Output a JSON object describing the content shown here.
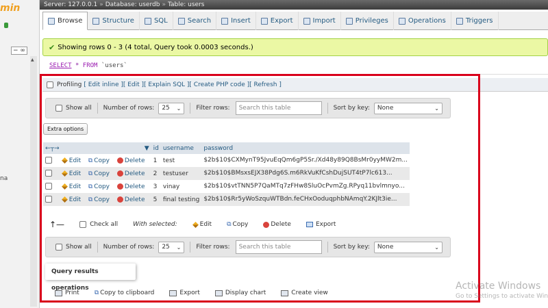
{
  "sidebar": {
    "logo": "min",
    "label_na": "na",
    "collapse": "− ∞"
  },
  "breadcrumb": {
    "server": "Server: 127.0.0.1",
    "database": "Database: userdb",
    "table": "Table: users",
    "sep": "»"
  },
  "tabs": [
    {
      "label": "Browse",
      "icon": "browse-icon"
    },
    {
      "label": "Structure",
      "icon": "structure-icon"
    },
    {
      "label": "SQL",
      "icon": "sql-icon"
    },
    {
      "label": "Search",
      "icon": "search-icon"
    },
    {
      "label": "Insert",
      "icon": "insert-icon"
    },
    {
      "label": "Export",
      "icon": "export-icon"
    },
    {
      "label": "Import",
      "icon": "import-icon"
    },
    {
      "label": "Privileges",
      "icon": "privileges-icon"
    },
    {
      "label": "Operations",
      "icon": "operations-icon"
    },
    {
      "label": "Triggers",
      "icon": "triggers-icon"
    }
  ],
  "message": {
    "text": "Showing rows 0 - 3 (4 total, Query took 0.0003 seconds.)"
  },
  "sql": {
    "select": "SELECT",
    "star": "*",
    "from": "FROM",
    "table": "`users`"
  },
  "profiling": {
    "label": "Profiling",
    "links": [
      "[ Edit inline ]",
      "[ Edit ]",
      "[ Explain SQL ]",
      "[ Create PHP code ]",
      "[ Refresh ]"
    ]
  },
  "nav": {
    "show_all": "Show all",
    "num_rows_label": "Number of rows:",
    "num_rows_value": "25",
    "filter_label": "Filter rows:",
    "filter_placeholder": "Search this table",
    "sort_label": "Sort by key:",
    "sort_value": "None"
  },
  "extra_options": "Extra options",
  "table": {
    "columns": [
      "id",
      "username",
      "password"
    ],
    "actions": {
      "edit": "Edit",
      "copy": "Copy",
      "delete": "Delete"
    },
    "rows": [
      {
        "id": "1",
        "username": "test",
        "password": "$2b$10$CXMynT95JvuEqQm6gP5Sr./Xd48y89Q8BsMr0yyMW2m..."
      },
      {
        "id": "2",
        "username": "testuser",
        "password": "$2b$10$BMsxsEJX38Pdg6S.m6RkVuKfCshDujSUT4tP7lc613..."
      },
      {
        "id": "3",
        "username": "vinay",
        "password": "$2b$10$vtTNN5P7QaMTq7zFHw8SluOcPvmZg.RPyq11bvlmnyo..."
      },
      {
        "id": "5",
        "username": "final testing",
        "password": "$2b$10$Rr5yWoSzquWTBdn.feCHxOoduqphbNAmqY.2KJlt3ie..."
      }
    ]
  },
  "bulk": {
    "check_all": "Check all",
    "with_selected": "With selected:",
    "edit": "Edit",
    "copy": "Copy",
    "delete": "Delete",
    "export": "Export"
  },
  "query_ops": {
    "title": "Query results operations",
    "items": [
      "Print",
      "Copy to clipboard",
      "Export",
      "Display chart",
      "Create view"
    ]
  },
  "watermark": {
    "line1": "Activate Windows",
    "line2": "Go to Settings to activate Windows."
  },
  "colors": {
    "highlight": "#d9001b",
    "link": "#235a81",
    "success_bg": "#ebf8a4"
  }
}
